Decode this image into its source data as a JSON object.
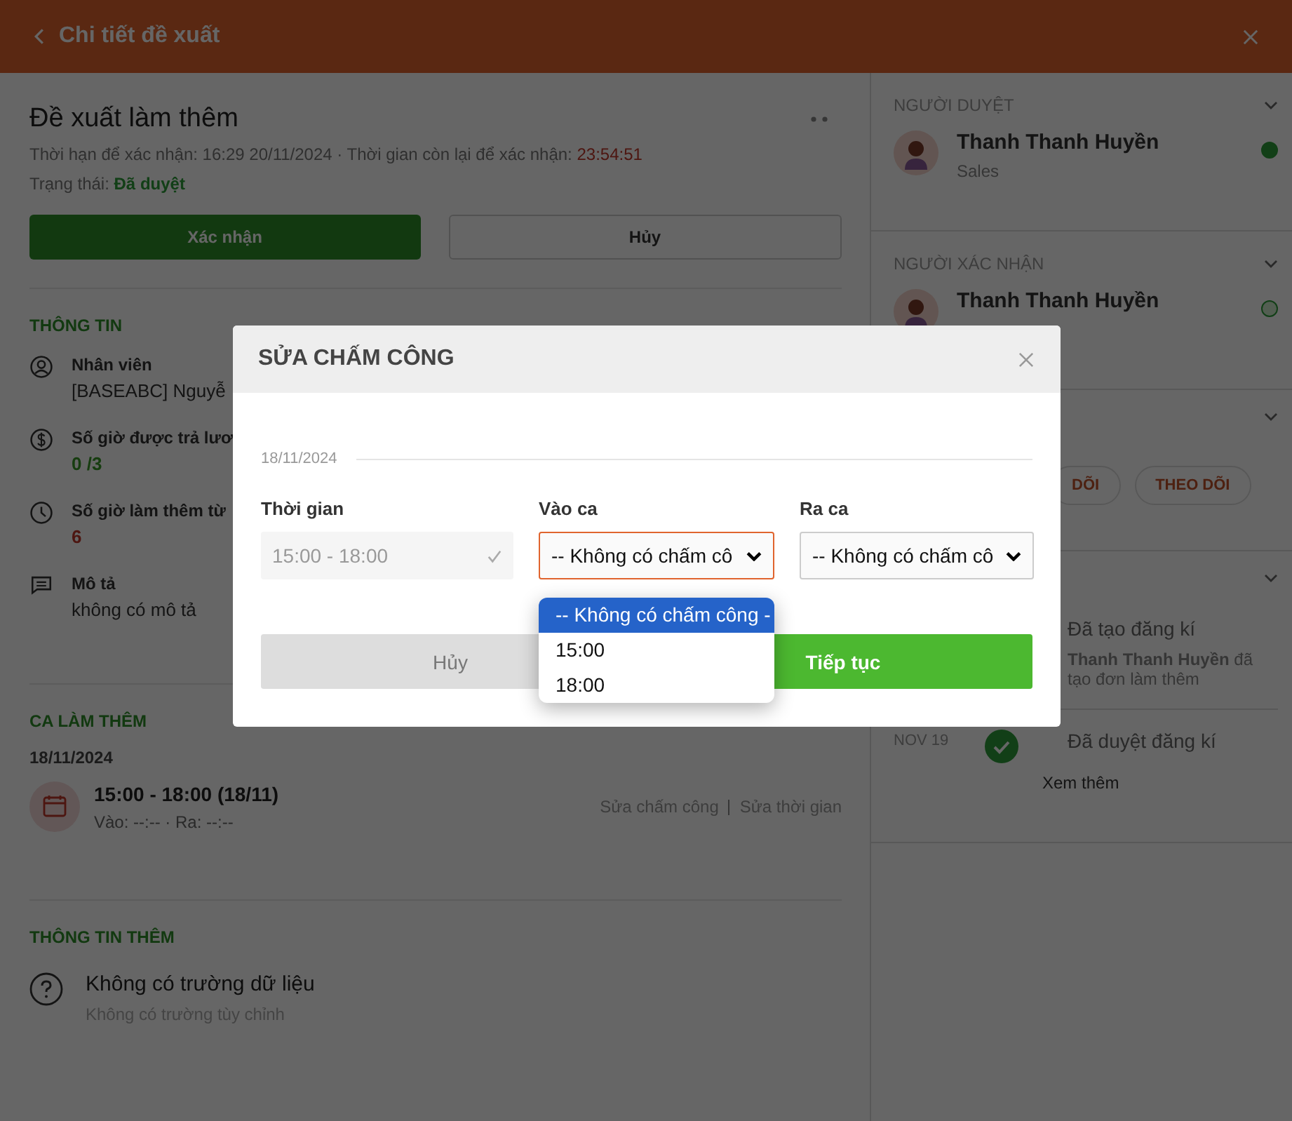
{
  "header": {
    "title": "Chi tiết đề xuất"
  },
  "proposal": {
    "title": "Đề xuất làm thêm",
    "deadline": "Thời hạn để xác nhận: 16:29 20/11/2024 · Thời gian còn lại để xác nhận:",
    "countdown": "23:54:51",
    "status_label": "Trạng thái:",
    "status": "Đã duyệt"
  },
  "actions": [
    {
      "label": "Xác nhận",
      "kind": "primary"
    },
    {
      "label": "Hủy",
      "kind": "secondary"
    }
  ],
  "info": {
    "heading": "THÔNG TIN",
    "items": [
      {
        "label": "Nhân viên",
        "value": "[BASEABC] Nguyễ",
        "kind": "text"
      },
      {
        "label": "Số giờ được trả lươ",
        "value": "0 /3",
        "kind": "positive"
      },
      {
        "label": "Số giờ làm thêm từ",
        "value": "6",
        "kind": "negative"
      },
      {
        "label": "Mô tả",
        "value": "không có mô tả",
        "kind": "text"
      }
    ]
  },
  "shift": {
    "heading": "CA LÀM THÊM",
    "date": "18/11/2024",
    "time": "15:00 - 18:00 (18/11)",
    "inout": "Vào: --:-- · Ra: --:--",
    "links": [
      "Sửa chấm công",
      "Sửa thời gian"
    ]
  },
  "extra": {
    "heading": "THÔNG TIN THÊM",
    "title": "Không có trường dữ liệu",
    "subtitle": "Không có trường tùy chỉnh"
  },
  "approver": {
    "heading": "NGƯỜI DUYỆT",
    "name": "Thanh Thanh Huyền",
    "role": "Sales",
    "done": true
  },
  "confirmer": {
    "heading": "NGƯỜI XÁC NHẬN",
    "name": "Thanh Thanh Huyền",
    "done": false
  },
  "followers": [
    "DÕI",
    "THEO DÕI"
  ],
  "timeline": [
    {
      "title": "Đã tạo đăng kí",
      "detail": "**Thanh Thanh Huyền** đã tạo đơn làm thêm"
    },
    {
      "date": "NOV 19",
      "title": "Đã duyệt đăng kí",
      "done": true
    }
  ],
  "more": "Xem thêm",
  "modal": {
    "title": "SỬA CHẤM CÔNG",
    "date": "18/11/2024",
    "time": {
      "label": "Thời gian",
      "value": "15:00 - 18:00"
    },
    "check_in": {
      "label": "Vào ca",
      "value": "-- Không có chấm cô",
      "open": true,
      "options": [
        {
          "label": "-- Không có chấm công -",
          "selected": true
        },
        {
          "label": "15:00",
          "selected": false
        },
        {
          "label": "18:00",
          "selected": false
        }
      ]
    },
    "check_out": {
      "label": "Ra ca",
      "value": "-- Không có chấm cô",
      "open": false
    },
    "buttons": [
      {
        "label": "Hủy",
        "kind": "secondary"
      },
      {
        "label": "Tiếp tục",
        "kind": "primary"
      }
    ]
  }
}
